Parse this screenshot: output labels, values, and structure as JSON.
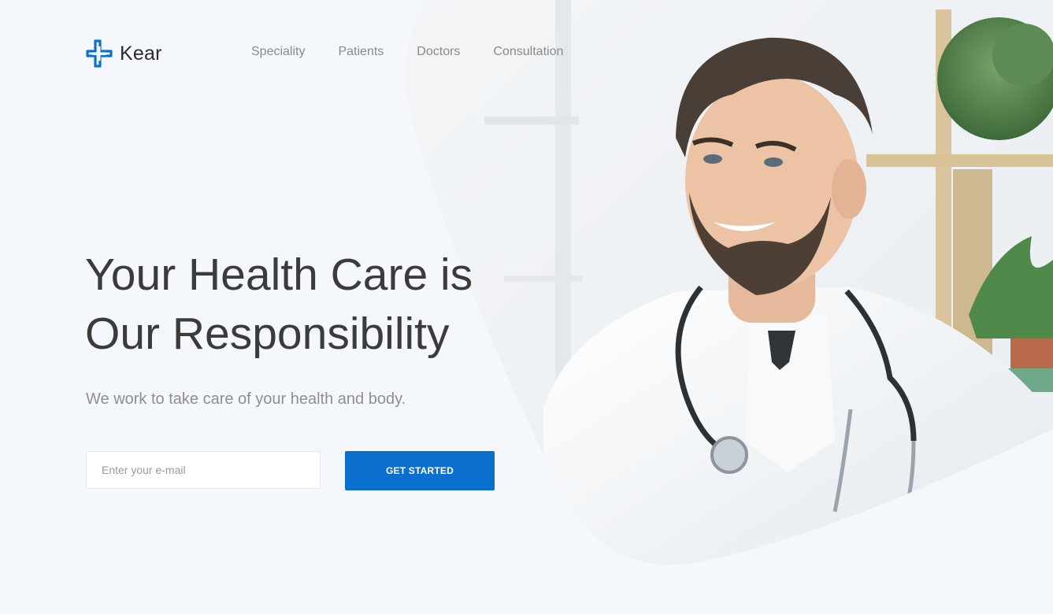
{
  "brand": {
    "name": "Kear",
    "icon": "medical-cross-icon",
    "color": "#0b6fcd"
  },
  "nav": {
    "items": [
      "Speciality",
      "Patients",
      "Doctors",
      "Consultation"
    ]
  },
  "hero": {
    "headline_line1": "Your Health Care is",
    "headline_line2": "Our Responsibility",
    "subtitle": "We work to take care of your health and body.",
    "email_placeholder": "Enter your e-mail",
    "email_value": "",
    "cta_label": "GET STARTED",
    "image": "smiling-doctor-with-stethoscope"
  },
  "colors": {
    "background": "#f4f8fc",
    "accent": "#0b6fcd",
    "headline": "#3b3b3b",
    "muted": "#8e8e8e"
  }
}
